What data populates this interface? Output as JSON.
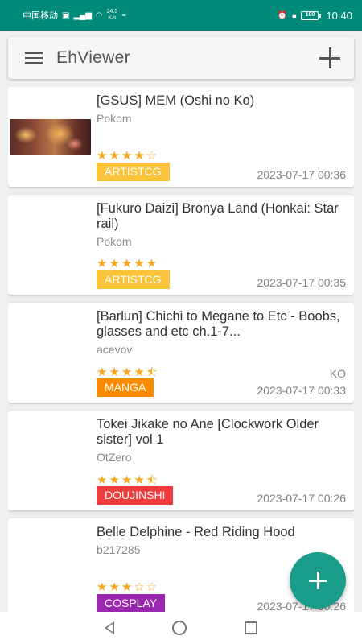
{
  "status_bar": {
    "carrier": "中国移动",
    "net_speed": "24.5",
    "net_unit": "K/s",
    "battery": "100",
    "time": "10:40"
  },
  "toolbar": {
    "title": "EhViewer",
    "menu_icon": "hamburger-menu-icon",
    "add_icon": "plus-icon"
  },
  "colors": {
    "accent": "#008a7a",
    "star": "#f5a623",
    "artistcg": "#f9c33a",
    "manga": "#fb8c00",
    "doujinshi": "#ee3b3b",
    "cosplay": "#9b27b0"
  },
  "galleries": [
    {
      "title": "[GSUS] MEM (Oshi no Ko)",
      "uploader": "Pokom",
      "stars": "★★★★☆",
      "rating": 4.0,
      "category": "ARTISTCG",
      "language": "",
      "date": "2023-07-17 00:36"
    },
    {
      "title": "[Fukuro Daizi] Bronya Land (Honkai: Star rail)",
      "uploader": "Pokom",
      "stars": "★★★★★",
      "rating": 5.0,
      "category": "ARTISTCG",
      "language": "",
      "date": "2023-07-17 00:35"
    },
    {
      "title": "[Barlun] Chichi to Megane to Etc - Boobs, glasses and etc ch.1-7...",
      "uploader": "acevov",
      "stars": "★★★★⯪",
      "rating": 4.5,
      "category": "MANGA",
      "language": "KO",
      "date": "2023-07-17 00:33"
    },
    {
      "title": "Tokei Jikake no Ane [Clockwork Older sister] vol 1",
      "uploader": "OtZero",
      "stars": "★★★★⯪",
      "rating": 4.5,
      "category": "DOUJINSHI",
      "language": "",
      "date": "2023-07-17 00:26"
    },
    {
      "title": "Belle Delphine - Red Riding Hood",
      "uploader": "b217285",
      "stars": "★★★☆☆",
      "rating": 3.0,
      "category": "COSPLAY",
      "language": "",
      "date": "2023-07-17 00:26"
    }
  ],
  "fab_icon": "plus-icon",
  "nav": {
    "back_icon": "back-triangle-icon",
    "home_icon": "home-circle-icon",
    "recent_icon": "recents-square-icon"
  }
}
